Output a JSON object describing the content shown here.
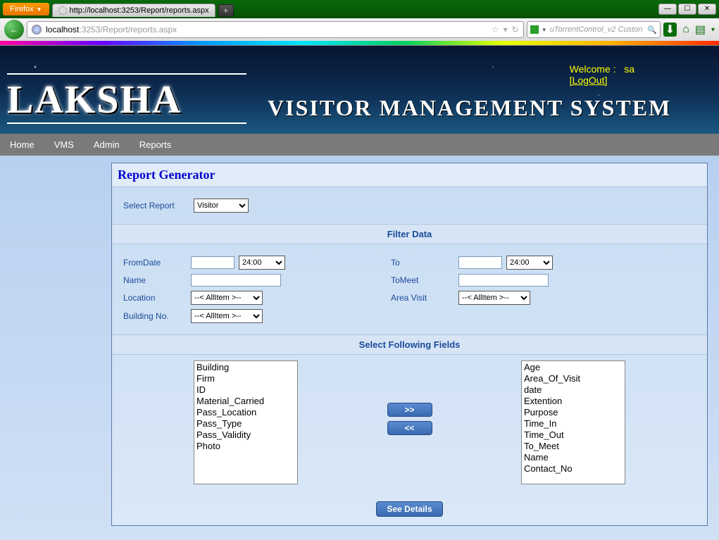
{
  "chrome": {
    "ff_label": "Firefox",
    "tab_title": "http://localhost:3253/Report/reports.aspx",
    "newtab": "+",
    "win_min": "—",
    "win_max": "☐",
    "win_close": "✕",
    "back_arrow": "←",
    "url_host": "localhost",
    "url_port": ":3253",
    "url_path": "/Report/reports.aspx",
    "star": "☆",
    "dropdown": "▾",
    "reload": "↻",
    "search_placeholder": "uTorrentControl_v2 Custon",
    "search_mag": "🔍",
    "tb_down": "⬇",
    "tb_home": "⌂",
    "tb_book": "▤",
    "tb_more": "▾"
  },
  "banner": {
    "logo": "LAKSHA",
    "subtitle": "VISITOR MANAGEMENT SYSTEM",
    "welcome_label": "Welcome :",
    "user": "sa",
    "logout": "[LogOut]"
  },
  "menu": {
    "items": [
      "Home",
      "VMS",
      "Admin",
      "Reports"
    ]
  },
  "report": {
    "title": "Report Generator",
    "select_label": "Select Report",
    "select_value": "Visitor",
    "filter_head": "Filter Data",
    "from_label": "FromDate",
    "from_time": "24:00",
    "to_label": "To",
    "to_time": "24:00",
    "name_label": "Name",
    "tomeet_label": "ToMeet",
    "location_label": "Location",
    "location_value": "--< AllItem >--",
    "area_label": "Area Visit",
    "area_value": "--< AllItem >--",
    "building_label": "Building No.",
    "building_value": "--< AllItem >--",
    "fields_head": "Select Following Fields",
    "left_list": [
      "Building",
      "Firm",
      "ID",
      "Material_Carried",
      "Pass_Location",
      "Pass_Type",
      "Pass_Validity",
      "Photo"
    ],
    "right_list": [
      "Age",
      "Area_Of_Visit",
      "date",
      "Extention",
      "Purpose",
      "Time_In",
      "Time_Out",
      "To_Meet",
      "Name",
      "Contact_No"
    ],
    "move_right": ">>",
    "move_left": "<<",
    "see_details": "See Details"
  }
}
